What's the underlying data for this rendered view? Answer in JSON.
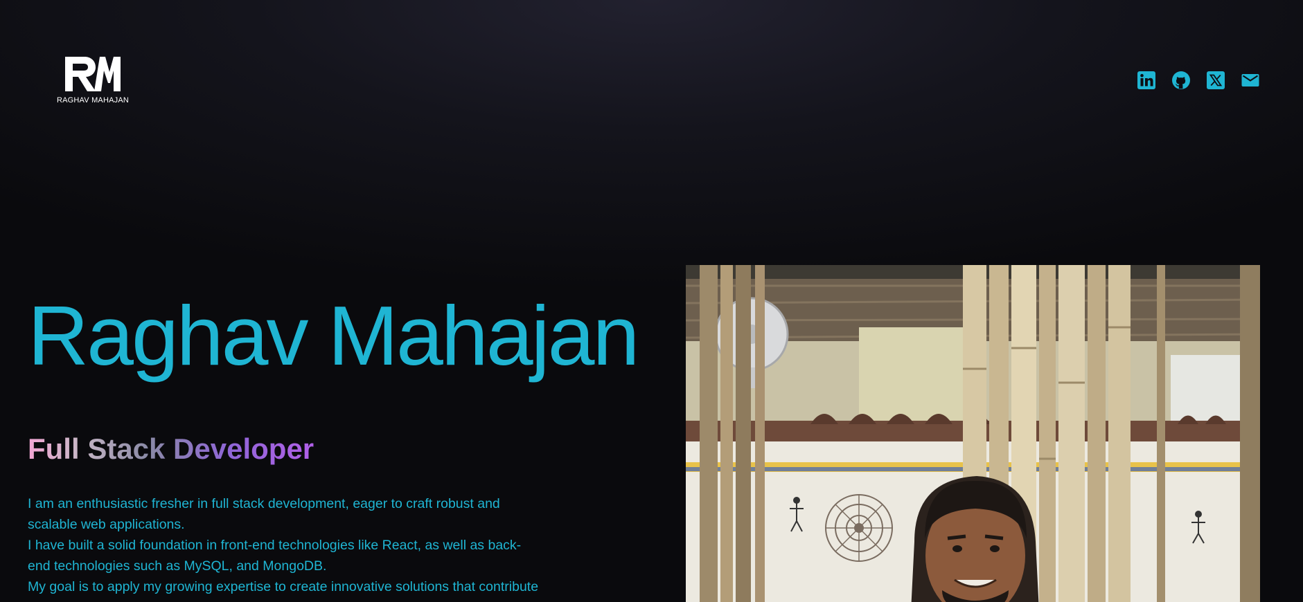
{
  "logo": {
    "monogram": "RM",
    "text": "RAGHAV MAHAJAN"
  },
  "social": [
    {
      "name": "linkedin",
      "icon": "linkedin-icon"
    },
    {
      "name": "github",
      "icon": "github-icon"
    },
    {
      "name": "x",
      "icon": "x-twitter-icon"
    },
    {
      "name": "email",
      "icon": "mail-icon"
    }
  ],
  "hero": {
    "name": "Raghav Mahajan",
    "role": "Full Stack Developer",
    "bio": [
      "I am an enthusiastic fresher in full stack development, eager to craft robust and scalable web applications.",
      "I have built a solid foundation in front-end technologies like React, as well as back-end technologies such as MySQL, and MongoDB.",
      "My goal is to apply my growing expertise to create innovative solutions that contribute"
    ]
  },
  "colors": {
    "accent": "#1fb5d3",
    "background": "#0a0a0d",
    "role_gradient": [
      "#f2a6d4",
      "#8a8aa6",
      "#b160e8"
    ]
  }
}
